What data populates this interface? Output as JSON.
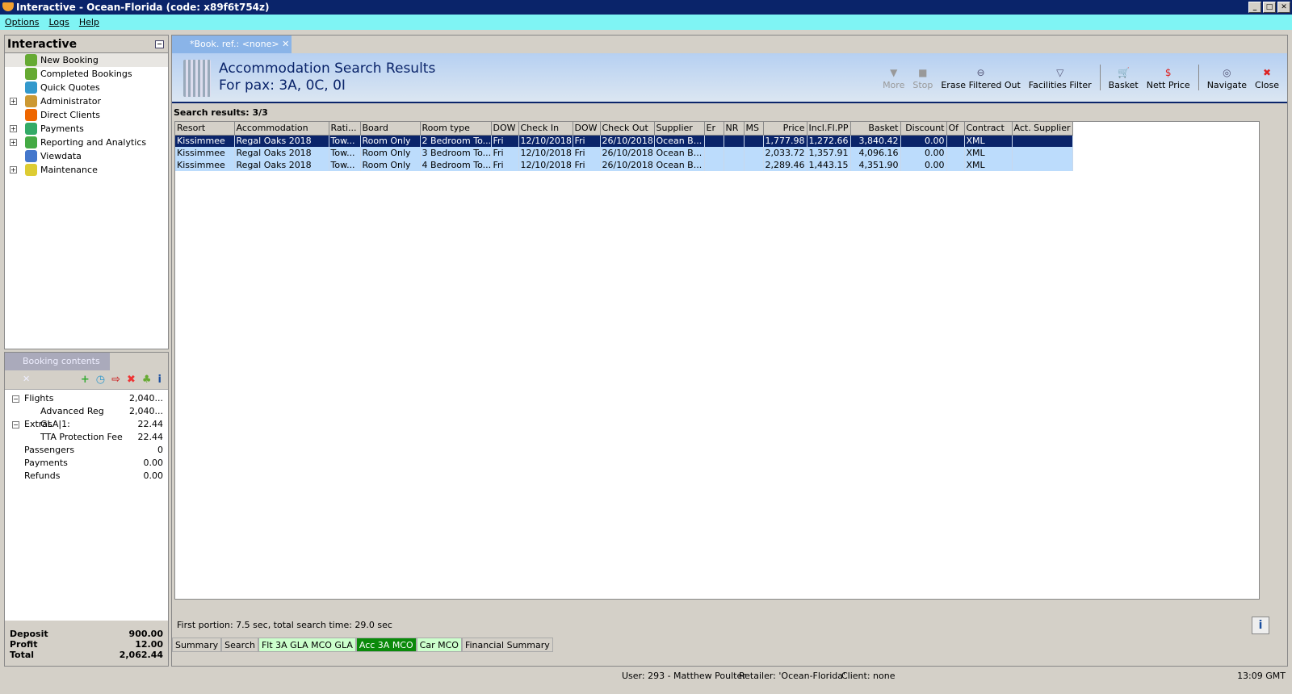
{
  "window": {
    "title": "Interactive - Ocean-Florida (code: x89f6t754z)"
  },
  "menu": [
    "Options",
    "Logs",
    "Help"
  ],
  "nav": {
    "title": "Interactive",
    "items": [
      {
        "label": "New Booking",
        "expandable": false,
        "icon": "palm-tree-icon",
        "color": "#6a3"
      },
      {
        "label": "Completed Bookings",
        "expandable": false,
        "icon": "palm-money-icon",
        "color": "#6a3"
      },
      {
        "label": "Quick Quotes",
        "expandable": false,
        "icon": "clock-icon",
        "color": "#39c"
      },
      {
        "label": "Administrator",
        "expandable": true,
        "icon": "runner-icon",
        "color": "#c93"
      },
      {
        "label": "Direct Clients",
        "expandable": false,
        "icon": "clients-icon",
        "color": "#e60"
      },
      {
        "label": "Payments",
        "expandable": true,
        "icon": "payments-icon",
        "color": "#3a6"
      },
      {
        "label": "Reporting and Analytics",
        "expandable": true,
        "icon": "report-icon",
        "color": "#4a4"
      },
      {
        "label": "Viewdata",
        "expandable": false,
        "icon": "globe-icon",
        "color": "#47c"
      },
      {
        "label": "Maintenance",
        "expandable": true,
        "icon": "maintenance-icon",
        "color": "#dc3"
      }
    ]
  },
  "booking": {
    "tab": "Booking contents",
    "rows": [
      {
        "label": "Flights",
        "value": "2,040...",
        "expand": true,
        "child": false
      },
      {
        "label": "Advanced Reg GLA|1:",
        "value": "2,040...",
        "expand": false,
        "child": true
      },
      {
        "label": "Extras",
        "value": "22.44",
        "expand": true,
        "child": false
      },
      {
        "label": "TTA Protection Fee",
        "value": "22.44",
        "expand": false,
        "child": true
      },
      {
        "label": "Passengers",
        "value": "0",
        "expand": false,
        "child": false
      },
      {
        "label": "Payments",
        "value": "0.00",
        "expand": false,
        "child": false
      },
      {
        "label": "Refunds",
        "value": "0.00",
        "expand": false,
        "child": false
      }
    ],
    "totals": [
      {
        "label": "Deposit",
        "value": "900.00"
      },
      {
        "label": "Profit",
        "value": "12.00"
      },
      {
        "label": "Total",
        "value": "2,062.44"
      }
    ]
  },
  "doc": {
    "tab": "*Book. ref.: <none>",
    "title": "Accommodation Search Results",
    "subtitle": "For pax: 3A, 0C, 0I"
  },
  "toolbar": [
    {
      "label": "More",
      "enabled": false,
      "icon": "▼"
    },
    {
      "label": "Stop",
      "enabled": false,
      "icon": "■"
    },
    {
      "label": "Erase Filtered Out",
      "enabled": true,
      "icon": "⊖"
    },
    {
      "label": "Facilities Filter",
      "enabled": true,
      "icon": "▽"
    },
    {
      "sep": true
    },
    {
      "label": "Basket",
      "enabled": true,
      "icon": "🛒"
    },
    {
      "label": "Nett Price",
      "enabled": true,
      "icon": "$"
    },
    {
      "sep": true
    },
    {
      "label": "Navigate",
      "enabled": true,
      "icon": "◎"
    },
    {
      "label": "Close",
      "enabled": true,
      "icon": "✖"
    }
  ],
  "results": {
    "label": "Search results: 3/3",
    "columns": [
      "Resort",
      "Accommodation",
      "Rati...",
      "Board",
      "Room type",
      "DOW",
      "Check In",
      "DOW",
      "Check Out",
      "Supplier",
      "Er",
      "NR",
      "MS",
      "Price",
      "Incl.Fl.PP",
      "Basket",
      "Discount",
      "Of",
      "Contract",
      "Act. Supplier"
    ],
    "rows": [
      [
        "Kissimmee",
        "Regal Oaks 2018",
        "Tow...",
        "Room Only",
        "2 Bedroom To...",
        "Fri",
        "12/10/2018",
        "Fri",
        "26/10/2018",
        "Ocean B...",
        "",
        "",
        "",
        "1,777.98",
        "1,272.66",
        "3,840.42",
        "0.00",
        "",
        "XML",
        ""
      ],
      [
        "Kissimmee",
        "Regal Oaks 2018",
        "Tow...",
        "Room Only",
        "3 Bedroom To...",
        "Fri",
        "12/10/2018",
        "Fri",
        "26/10/2018",
        "Ocean B...",
        "",
        "",
        "",
        "2,033.72",
        "1,357.91",
        "4,096.16",
        "0.00",
        "",
        "XML",
        ""
      ],
      [
        "Kissimmee",
        "Regal Oaks 2018",
        "Tow...",
        "Room Only",
        "4 Bedroom To...",
        "Fri",
        "12/10/2018",
        "Fri",
        "26/10/2018",
        "Ocean B...",
        "",
        "",
        "",
        "2,289.46",
        "1,443.15",
        "4,351.90",
        "0.00",
        "",
        "XML",
        ""
      ]
    ],
    "selected_row": 0
  },
  "timing": "First portion: 7.5 sec, total search time: 29.0 sec",
  "bottom_tabs": [
    {
      "label": "Summary",
      "style": ""
    },
    {
      "label": "Search",
      "style": ""
    },
    {
      "label": "Flt 3A GLA MCO GLA",
      "style": "g"
    },
    {
      "label": "Acc 3A MCO",
      "style": "dg"
    },
    {
      "label": "Car MCO",
      "style": "g"
    },
    {
      "label": "Financial Summary",
      "style": ""
    }
  ],
  "status": {
    "user": "User: 293 - Matthew Poulter",
    "retailer": "Retailer: 'Ocean-Florida'",
    "client": "Client: none",
    "time": "13:09 GMT"
  }
}
